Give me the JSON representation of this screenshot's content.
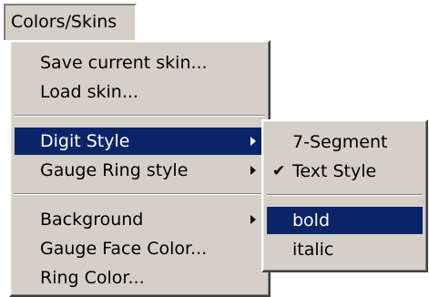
{
  "menubar": {
    "label": "Colors/Skins"
  },
  "main_menu": {
    "items": [
      {
        "label": "Save current skin..."
      },
      {
        "label": "Load skin..."
      },
      {
        "label": "Digit Style"
      },
      {
        "label": "Gauge Ring style"
      },
      {
        "label": "Background"
      },
      {
        "label": "Gauge Face Color..."
      },
      {
        "label": "Ring Color..."
      }
    ],
    "active_item": "Digit Style"
  },
  "submenu": {
    "items": [
      {
        "label": "7-Segment"
      },
      {
        "label": "Text Style",
        "checked": true
      },
      {
        "label": "bold"
      },
      {
        "label": "italic"
      }
    ],
    "active_item": "bold",
    "check_glyph": "✔"
  },
  "colors": {
    "menu_bg": "#d4d0c8",
    "highlight_bg": "#0a246a",
    "highlight_text": "#ffffff"
  }
}
